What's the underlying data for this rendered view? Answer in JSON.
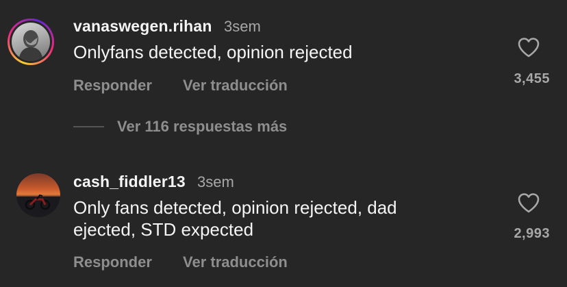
{
  "comments": [
    {
      "username": "vanaswegen.rihan",
      "time": "3sem",
      "text": "Onlyfans detected, opinion rejected",
      "reply_label": "Responder",
      "translate_label": "Ver traducción",
      "likes": "3,455",
      "avatar": "story-ring-avatar"
    },
    {
      "username": "cash_fiddler13",
      "time": "3sem",
      "text": "Only fans detected, opinion rejected, dad ejected, STD expected",
      "reply_label": "Responder",
      "translate_label": "Ver traducción",
      "likes": "2,993",
      "avatar": "sunset-motorbike-avatar"
    }
  ],
  "replies_toggle": {
    "label": "Ver 116 respuestas más"
  },
  "colors": {
    "background": "#262626",
    "primary_text": "#f5f5f5",
    "secondary_text": "#8e8e8e"
  },
  "icons": {
    "like": "heart-outline-icon"
  }
}
